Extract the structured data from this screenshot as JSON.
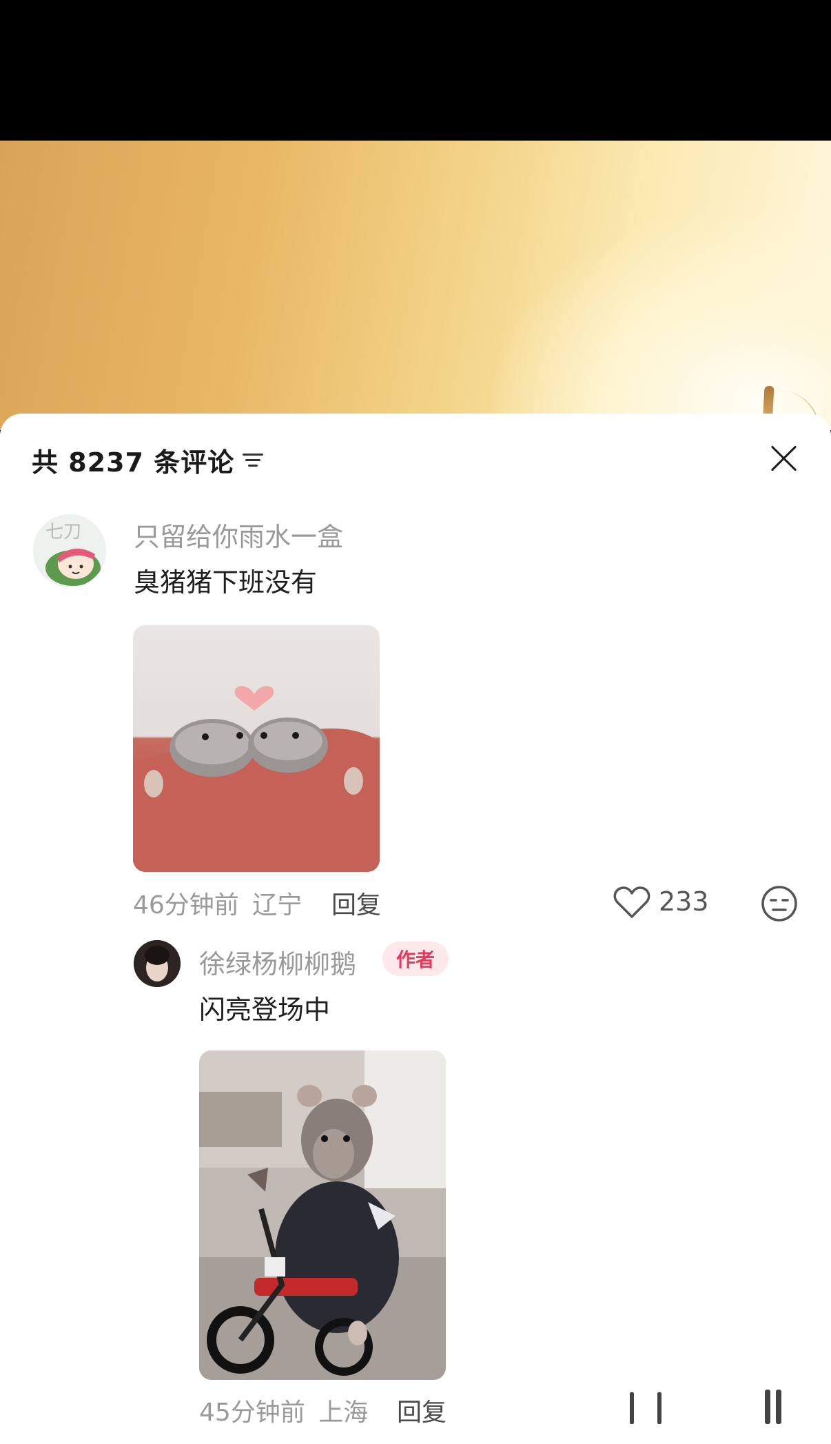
{
  "header": {
    "comment_count_label": "共 8237 条评论"
  },
  "comments": [
    {
      "username": "只留给你雨水一盒",
      "text": "臭猪猪下班没有",
      "time": "46分钟前",
      "location": "辽宁",
      "reply_label": "回复",
      "like_count": "233",
      "avatar_text": "七刀"
    },
    {
      "username": "徐绿杨柳柳鹅",
      "badge": "作者",
      "text": "闪亮登场中",
      "time": "45分钟前",
      "location": "上海",
      "reply_label": "回复"
    }
  ],
  "icons": {
    "filter": "sort-filter-icon",
    "close": "close-icon",
    "like": "heart-outline-icon",
    "emoji": "meh-face-icon"
  },
  "colors": {
    "sheet_bg": "#ffffff",
    "author_badge_text": "#e8395a",
    "author_badge_bg": "#fde8ec",
    "muted_text": "#999999"
  }
}
